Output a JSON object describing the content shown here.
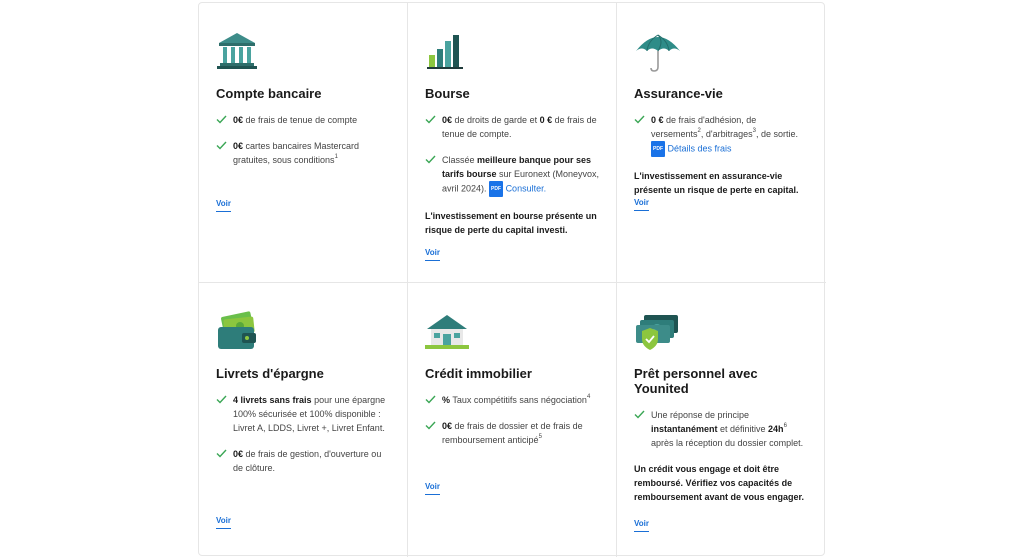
{
  "cards": [
    {
      "icon": "bank-icon",
      "title": "Compte bancaire",
      "features": [
        {
          "bold": "0€",
          "text": " de frais de tenue de compte"
        },
        {
          "bold": "0€",
          "text": " cartes bancaires Mastercard gratuites, sous conditions",
          "sup": "1"
        }
      ],
      "link": "Voir"
    },
    {
      "icon": "bar-chart-icon",
      "title": "Bourse",
      "features": [
        {
          "p1b": "0€",
          "p2": " de droits de garde et ",
          "p3b": "0 €",
          "p4": " de frais de tenue de compte."
        },
        {
          "p1": "Classée ",
          "p2b": "meilleure banque pour ses tarifs bourse",
          "p3": " sur Euronext (Moneyvox, avril 2024).",
          "pdf": "PDF",
          "lnk": "Consulter."
        }
      ],
      "warning": "L'investissement en bourse présente un risque de perte du capital investi.",
      "link": "Voir"
    },
    {
      "icon": "umbrella-icon",
      "title": "Assurance-vie",
      "features": [
        {
          "p1b": "0 €",
          "p2": " de frais d'adhésion, de versements",
          "sup1": "2",
          "p3": ", d'arbitrages",
          "sup2": "3",
          "p4": ", de sortie.",
          "pdf": "PDF",
          "lnk": "Détails des frais"
        }
      ],
      "warning": "L'investissement en assurance-vie présente un risque de perte en capital.",
      "link": "Voir"
    },
    {
      "icon": "wallet-icon",
      "title": "Livrets d'épargne",
      "features": [
        {
          "bold": "4 livrets sans frais",
          "text": " pour une épargne 100% sécurisée et 100% disponible : Livret A, LDDS, Livret +, Livret Enfant."
        },
        {
          "bold": "0€",
          "text": " de frais de gestion, d'ouverture ou de clôture."
        }
      ],
      "link": "Voir"
    },
    {
      "icon": "house-icon",
      "title": "Crédit immobilier",
      "features": [
        {
          "bold": "%",
          "text": " Taux compétitifs sans négociation",
          "sup": "4"
        },
        {
          "bold": "0€",
          "text": " de frais de dossier et de frais de remboursement anticipé",
          "sup": "5"
        }
      ],
      "link": "Voir"
    },
    {
      "icon": "cash-shield-icon",
      "title": "Prêt personnel avec Younited",
      "features": [
        {
          "p1": "Une réponse de principe ",
          "p2b": "instantanément",
          "p3": " et définitive ",
          "p4b": "24h",
          "sup": "6",
          "p5": " après la réception du dossier complet."
        }
      ],
      "warning": "Un crédit vous engage et doit être remboursé. Vérifiez vos capacités de remboursement avant de vous engager.",
      "link": "Voir"
    }
  ],
  "colors": {
    "accent": "#1a6fd6",
    "check": "#3aa655",
    "teal": "#2e7d7a"
  }
}
